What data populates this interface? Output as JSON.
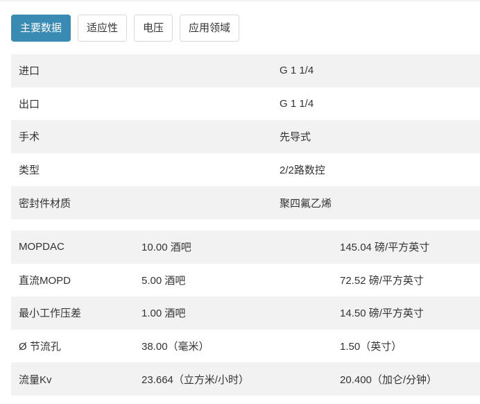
{
  "tabs": [
    {
      "label": "主要数据",
      "active": true
    },
    {
      "label": "适应性",
      "active": false
    },
    {
      "label": "电压",
      "active": false
    },
    {
      "label": "应用领域",
      "active": false
    }
  ],
  "main_table": [
    {
      "label": "进口",
      "value": "G 1 1/4"
    },
    {
      "label": "出口",
      "value": "G 1 1/4"
    },
    {
      "label": "手术",
      "value": "先导式"
    },
    {
      "label": "类型",
      "value": "2/2路数控"
    },
    {
      "label": "密封件材质",
      "value": "聚四氟乙烯"
    }
  ],
  "spec_table": [
    {
      "label": "MOPDAC",
      "metric": "10.00 酒吧",
      "imperial": "145.04 磅/平方英寸"
    },
    {
      "label": "直流MOPD",
      "metric": "5.00 酒吧",
      "imperial": "72.52 磅/平方英寸"
    },
    {
      "label": "最小工作压差",
      "metric": "1.00 酒吧",
      "imperial": "14.50 磅/平方英寸"
    },
    {
      "label": "Ø 节流孔",
      "metric": "38.00（毫米）",
      "imperial": "1.50（英寸）"
    },
    {
      "label": "流量Kv",
      "metric": "23.664（立方米/小时）",
      "imperial": "20.400（加仑/分钟）"
    }
  ],
  "colors": {
    "accent": "#3a8bb3",
    "row_shade": "#f2f2f2",
    "text": "#333333"
  }
}
